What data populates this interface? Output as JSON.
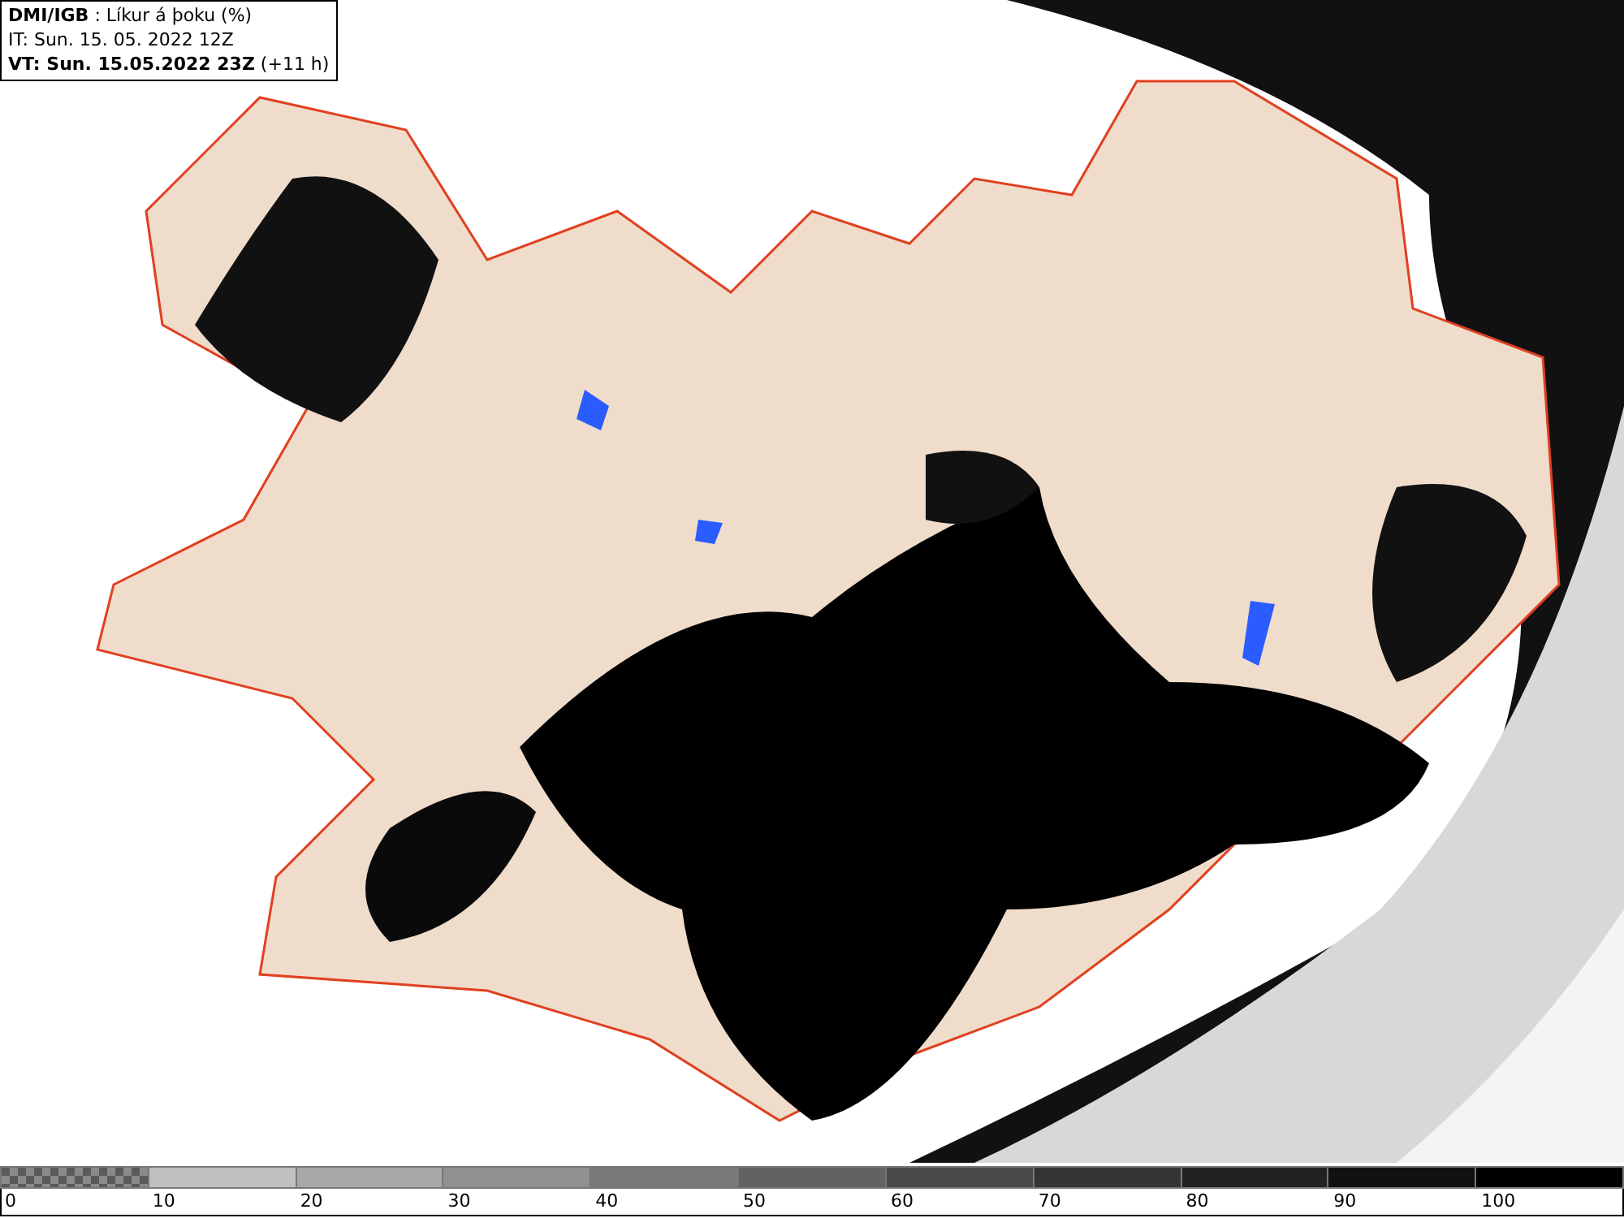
{
  "title_box": {
    "lines": [
      "**DMI/IGB** : Líkur á þoku (%)",
      "IT: Sun. 15. 05. 2022 12Z",
      "**VT: Sun. 15.05.2022 23Z** (+11 h)"
    ]
  },
  "legend": {
    "bins": [
      {
        "kind": "checker",
        "color": "#8a8a8a"
      },
      {
        "kind": "solid",
        "color": "#c0c0c0"
      },
      {
        "kind": "solid",
        "color": "#a8a8a8"
      },
      {
        "kind": "solid",
        "color": "#909090"
      },
      {
        "kind": "solid",
        "color": "#787878"
      },
      {
        "kind": "solid",
        "color": "#626262"
      },
      {
        "kind": "solid",
        "color": "#4a4a4a"
      },
      {
        "kind": "solid",
        "color": "#343434"
      },
      {
        "kind": "solid",
        "color": "#222222"
      },
      {
        "kind": "solid",
        "color": "#111111"
      },
      {
        "kind": "solid",
        "color": "#000000"
      }
    ],
    "labels": [
      "0",
      "10",
      "20",
      "30",
      "40",
      "50",
      "60",
      "70",
      "80",
      "90",
      "100"
    ]
  }
}
